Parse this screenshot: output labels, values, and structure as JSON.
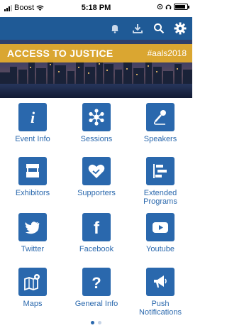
{
  "status": {
    "carrier": "Boost",
    "time": "5:18 PM"
  },
  "banner": {
    "title": "ACCESS TO JUSTICE",
    "hashtag": "#aals2018"
  },
  "toolbar": {
    "icons": [
      "bell-icon",
      "download-icon",
      "search-icon",
      "gear-icon"
    ]
  },
  "tiles": [
    {
      "label": "Event Info",
      "icon": "info-icon"
    },
    {
      "label": "Sessions",
      "icon": "sessions-network-icon"
    },
    {
      "label": "Speakers",
      "icon": "microphone-icon"
    },
    {
      "label": "Exhibitors",
      "icon": "exhibit-booth-icon"
    },
    {
      "label": "Supporters",
      "icon": "handshake-heart-icon"
    },
    {
      "label": "Extended Programs",
      "icon": "timeline-icon"
    },
    {
      "label": "Twitter",
      "icon": "twitter-bird-icon"
    },
    {
      "label": "Facebook",
      "icon": "facebook-icon"
    },
    {
      "label": "Youtube",
      "icon": "youtube-play-icon"
    },
    {
      "label": "Maps",
      "icon": "map-pin-icon"
    },
    {
      "label": "General Info",
      "icon": "question-mark-icon"
    },
    {
      "label": "Push Notifications",
      "icon": "megaphone-icon"
    }
  ],
  "pager": {
    "pages": 2,
    "current": 1
  },
  "colors": {
    "accent": "#2a68ad",
    "toolbar": "#1f5a96",
    "banner_stripe": "#e8af2d"
  }
}
